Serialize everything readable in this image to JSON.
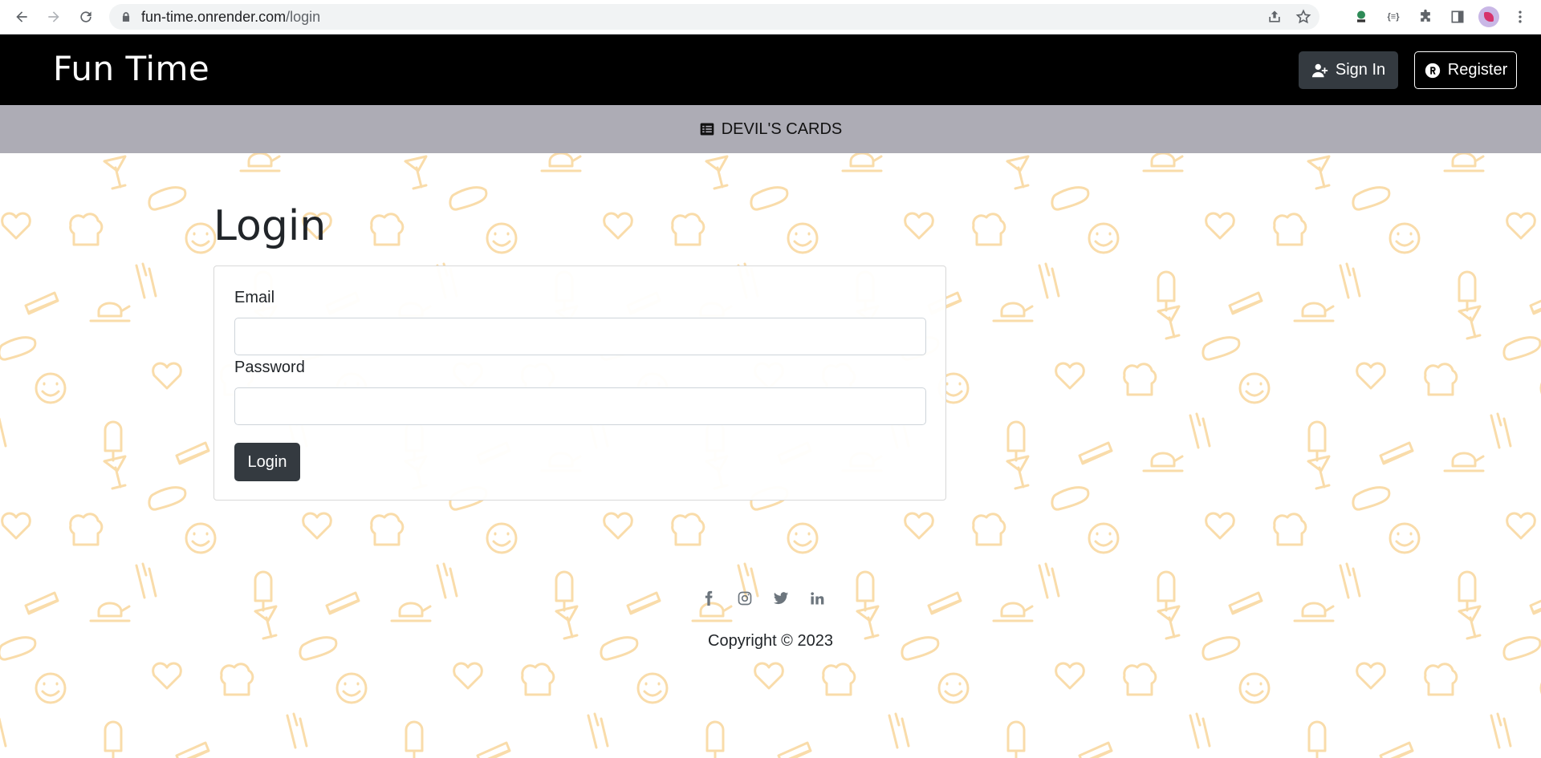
{
  "browser": {
    "url_host": "fun-time.onrender.com",
    "url_path": "/login"
  },
  "header": {
    "brand": "Fun Time",
    "signin_label": "Sign In",
    "register_label": "Register"
  },
  "subnav": {
    "link_label": "DEVIL'S CARDS"
  },
  "login": {
    "title": "Login",
    "email_label": "Email",
    "email_value": "",
    "password_label": "Password",
    "password_value": "",
    "submit_label": "Login"
  },
  "footer": {
    "social_icons": [
      "facebook-icon",
      "instagram-icon",
      "twitter-icon",
      "linkedin-icon"
    ],
    "copyright": "Copyright © 2023"
  },
  "colors": {
    "header_bg": "#000000",
    "subnav_bg": "#adacb5",
    "button_dark": "#343a40",
    "pattern": "#f9dcaa"
  }
}
